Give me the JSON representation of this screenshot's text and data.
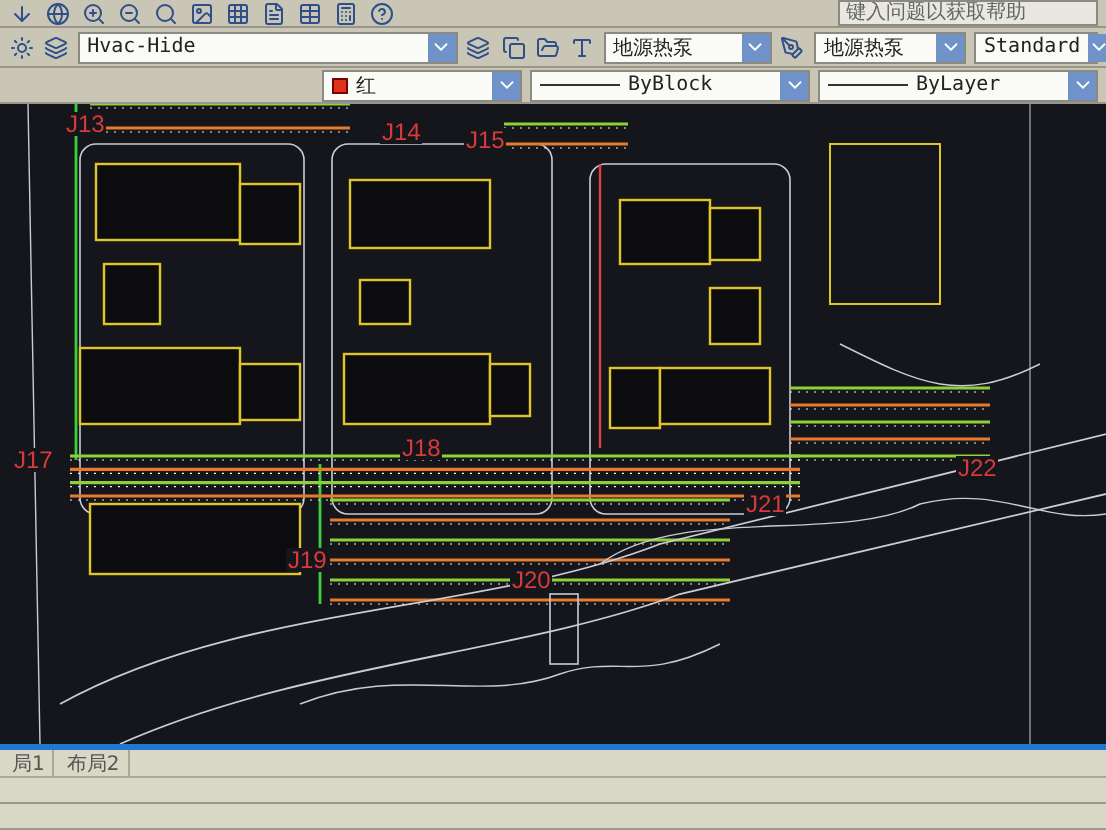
{
  "help_search": {
    "placeholder": "键入问题以获取帮助"
  },
  "layer": {
    "value": "Hvac-Hide"
  },
  "text_style": {
    "value": "地源热泵"
  },
  "dim_style": {
    "value": "地源热泵"
  },
  "table_style": {
    "value": "Standard"
  },
  "color": {
    "value": "红"
  },
  "linetype": {
    "value": "ByBlock"
  },
  "lineweight": {
    "value": "ByLayer"
  },
  "pipe_labels": [
    {
      "text": "J13"
    },
    {
      "text": "J14"
    },
    {
      "text": "J15"
    },
    {
      "text": "J17"
    },
    {
      "text": "J18"
    },
    {
      "text": "J19"
    },
    {
      "text": "J20"
    },
    {
      "text": "J21"
    },
    {
      "text": "J22"
    }
  ],
  "layout_tabs": [
    {
      "label": "局1",
      "selected": false
    },
    {
      "label": "布局2",
      "selected": false
    }
  ]
}
